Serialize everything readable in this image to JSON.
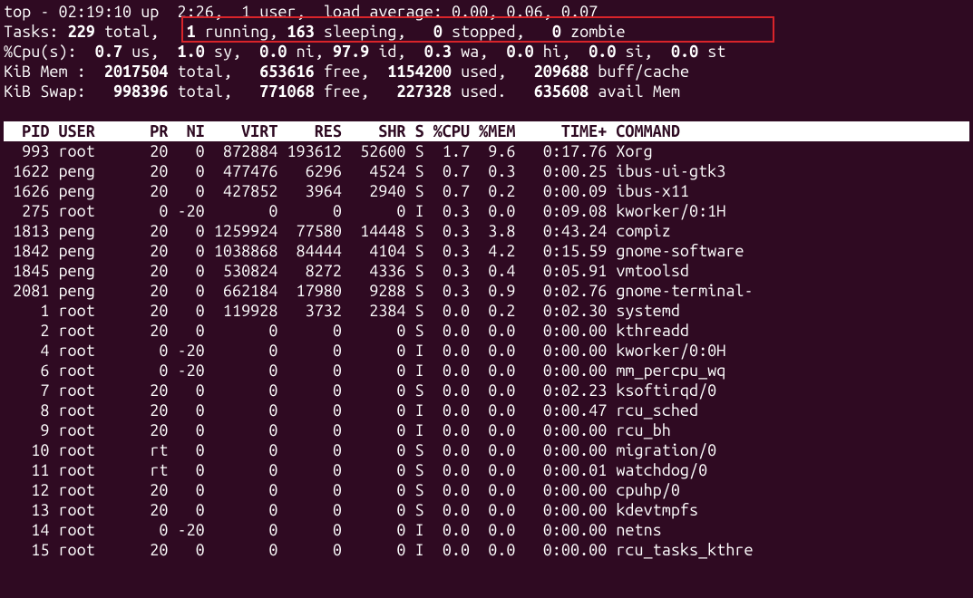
{
  "summary": {
    "line1_pre": "top - ",
    "time": "02:19:10",
    "up": " up  ",
    "uptime": "2:26",
    "sep1": ",  ",
    "users": "1 user",
    "sep2": ",  load average: ",
    "la": "0.00, 0.06, 0.07",
    "tasks_label": "Tasks:",
    "tasks_total": " 229 ",
    "total_word": "total,   ",
    "running": "1 ",
    "running_word": "running, ",
    "sleeping": "163 ",
    "sleeping_word": "sleeping,   ",
    "stopped": "0 ",
    "stopped_word": "stopped,   ",
    "zombie": "0 ",
    "zombie_word": "zombie",
    "cpu_label": "%Cpu(s):",
    "cpu_us": "  0.7 ",
    "us": "us,",
    "cpu_sy": "  1.0 ",
    "sy": "sy,",
    "cpu_ni": "  0.0 ",
    "ni": "ni,",
    "cpu_id": " 97.9 ",
    "id": "id,",
    "cpu_wa": "  0.3 ",
    "wa": "wa,",
    "cpu_hi": "  0.0 ",
    "hi": "hi,",
    "cpu_si": "  0.0 ",
    "si": "si,",
    "cpu_st": "  0.0 ",
    "st": "st",
    "mem_label": "KiB Mem :",
    "mem_total": "  2017504 ",
    "mem_total_w": "total,",
    "mem_free": "   653616 ",
    "mem_free_w": "free,",
    "mem_used": "  1154200 ",
    "mem_used_w": "used,",
    "mem_buff": "   209688 ",
    "mem_buff_w": "buff/cache",
    "swap_label": "KiB Swap:",
    "swap_total": "   998396 ",
    "swap_total_w": "total,",
    "swap_free": "   771068 ",
    "swap_free_w": "free,",
    "swap_used": "   227328 ",
    "swap_used_w": "used.",
    "swap_avail": "   635608 ",
    "swap_avail_w": "avail Mem"
  },
  "columns": "  PID USER      PR  NI    VIRT    RES    SHR S %CPU %MEM     TIME+ COMMAND                   ",
  "rows": [
    {
      "pid": "993",
      "user": "root",
      "pr": "20",
      "ni": "0",
      "virt": "872884",
      "res": "193612",
      "shr": "52600",
      "s": "S",
      "cpu": "1.7",
      "mem": "9.6",
      "time": "0:17.76",
      "cmd": "Xorg"
    },
    {
      "pid": "1622",
      "user": "peng",
      "pr": "20",
      "ni": "0",
      "virt": "477476",
      "res": "6296",
      "shr": "4524",
      "s": "S",
      "cpu": "0.7",
      "mem": "0.3",
      "time": "0:00.25",
      "cmd": "ibus-ui-gtk3"
    },
    {
      "pid": "1626",
      "user": "peng",
      "pr": "20",
      "ni": "0",
      "virt": "427852",
      "res": "3964",
      "shr": "2940",
      "s": "S",
      "cpu": "0.7",
      "mem": "0.2",
      "time": "0:00.09",
      "cmd": "ibus-x11"
    },
    {
      "pid": "275",
      "user": "root",
      "pr": "0",
      "ni": "-20",
      "virt": "0",
      "res": "0",
      "shr": "0",
      "s": "I",
      "cpu": "0.3",
      "mem": "0.0",
      "time": "0:09.08",
      "cmd": "kworker/0:1H"
    },
    {
      "pid": "1813",
      "user": "peng",
      "pr": "20",
      "ni": "0",
      "virt": "1259924",
      "res": "77580",
      "shr": "14448",
      "s": "S",
      "cpu": "0.3",
      "mem": "3.8",
      "time": "0:43.24",
      "cmd": "compiz"
    },
    {
      "pid": "1842",
      "user": "peng",
      "pr": "20",
      "ni": "0",
      "virt": "1038868",
      "res": "84444",
      "shr": "4104",
      "s": "S",
      "cpu": "0.3",
      "mem": "4.2",
      "time": "0:15.59",
      "cmd": "gnome-software"
    },
    {
      "pid": "1845",
      "user": "peng",
      "pr": "20",
      "ni": "0",
      "virt": "530824",
      "res": "8272",
      "shr": "4336",
      "s": "S",
      "cpu": "0.3",
      "mem": "0.4",
      "time": "0:05.91",
      "cmd": "vmtoolsd"
    },
    {
      "pid": "2081",
      "user": "peng",
      "pr": "20",
      "ni": "0",
      "virt": "662184",
      "res": "17980",
      "shr": "9288",
      "s": "S",
      "cpu": "0.3",
      "mem": "0.9",
      "time": "0:02.76",
      "cmd": "gnome-terminal-"
    },
    {
      "pid": "1",
      "user": "root",
      "pr": "20",
      "ni": "0",
      "virt": "119928",
      "res": "3732",
      "shr": "2384",
      "s": "S",
      "cpu": "0.0",
      "mem": "0.2",
      "time": "0:02.30",
      "cmd": "systemd"
    },
    {
      "pid": "2",
      "user": "root",
      "pr": "20",
      "ni": "0",
      "virt": "0",
      "res": "0",
      "shr": "0",
      "s": "S",
      "cpu": "0.0",
      "mem": "0.0",
      "time": "0:00.00",
      "cmd": "kthreadd"
    },
    {
      "pid": "4",
      "user": "root",
      "pr": "0",
      "ni": "-20",
      "virt": "0",
      "res": "0",
      "shr": "0",
      "s": "I",
      "cpu": "0.0",
      "mem": "0.0",
      "time": "0:00.00",
      "cmd": "kworker/0:0H"
    },
    {
      "pid": "6",
      "user": "root",
      "pr": "0",
      "ni": "-20",
      "virt": "0",
      "res": "0",
      "shr": "0",
      "s": "I",
      "cpu": "0.0",
      "mem": "0.0",
      "time": "0:00.00",
      "cmd": "mm_percpu_wq"
    },
    {
      "pid": "7",
      "user": "root",
      "pr": "20",
      "ni": "0",
      "virt": "0",
      "res": "0",
      "shr": "0",
      "s": "S",
      "cpu": "0.0",
      "mem": "0.0",
      "time": "0:02.23",
      "cmd": "ksoftirqd/0"
    },
    {
      "pid": "8",
      "user": "root",
      "pr": "20",
      "ni": "0",
      "virt": "0",
      "res": "0",
      "shr": "0",
      "s": "I",
      "cpu": "0.0",
      "mem": "0.0",
      "time": "0:00.47",
      "cmd": "rcu_sched"
    },
    {
      "pid": "9",
      "user": "root",
      "pr": "20",
      "ni": "0",
      "virt": "0",
      "res": "0",
      "shr": "0",
      "s": "I",
      "cpu": "0.0",
      "mem": "0.0",
      "time": "0:00.00",
      "cmd": "rcu_bh"
    },
    {
      "pid": "10",
      "user": "root",
      "pr": "rt",
      "ni": "0",
      "virt": "0",
      "res": "0",
      "shr": "0",
      "s": "S",
      "cpu": "0.0",
      "mem": "0.0",
      "time": "0:00.00",
      "cmd": "migration/0"
    },
    {
      "pid": "11",
      "user": "root",
      "pr": "rt",
      "ni": "0",
      "virt": "0",
      "res": "0",
      "shr": "0",
      "s": "S",
      "cpu": "0.0",
      "mem": "0.0",
      "time": "0:00.01",
      "cmd": "watchdog/0"
    },
    {
      "pid": "12",
      "user": "root",
      "pr": "20",
      "ni": "0",
      "virt": "0",
      "res": "0",
      "shr": "0",
      "s": "S",
      "cpu": "0.0",
      "mem": "0.0",
      "time": "0:00.00",
      "cmd": "cpuhp/0"
    },
    {
      "pid": "13",
      "user": "root",
      "pr": "20",
      "ni": "0",
      "virt": "0",
      "res": "0",
      "shr": "0",
      "s": "S",
      "cpu": "0.0",
      "mem": "0.0",
      "time": "0:00.00",
      "cmd": "kdevtmpfs"
    },
    {
      "pid": "14",
      "user": "root",
      "pr": "0",
      "ni": "-20",
      "virt": "0",
      "res": "0",
      "shr": "0",
      "s": "I",
      "cpu": "0.0",
      "mem": "0.0",
      "time": "0:00.00",
      "cmd": "netns"
    },
    {
      "pid": "15",
      "user": "root",
      "pr": "20",
      "ni": "0",
      "virt": "0",
      "res": "0",
      "shr": "0",
      "s": "I",
      "cpu": "0.0",
      "mem": "0.0",
      "time": "0:00.00",
      "cmd": "rcu_tasks_kthre"
    }
  ]
}
